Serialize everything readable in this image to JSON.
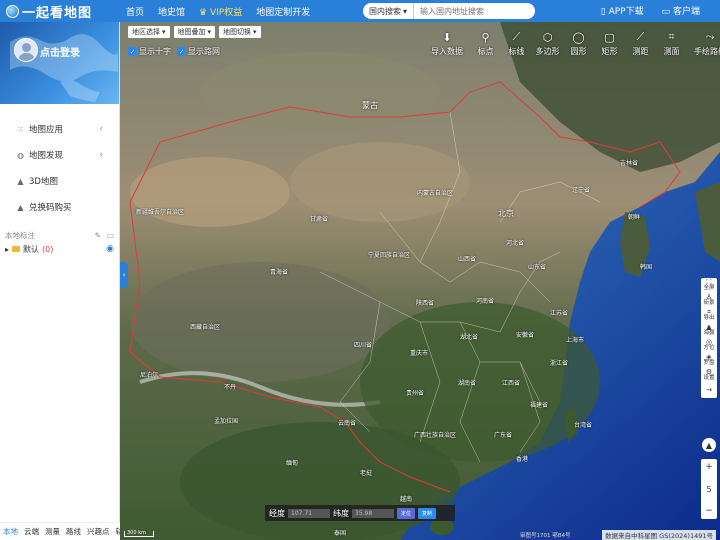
{
  "topbar": {
    "logo_text": "一起看地图",
    "nav": [
      "首页",
      "地史馆",
      "VIP权益",
      "地图定制开发"
    ],
    "search_select": "国内搜索",
    "search_placeholder": "输入国内地址搜索",
    "app_download": "APP下载",
    "client": "客户端"
  },
  "sidebar": {
    "login": "点击登录",
    "menu": [
      {
        "label": "地图应用",
        "icon": "grid-icon"
      },
      {
        "label": "地图发现",
        "icon": "globe-icon"
      },
      {
        "label": "3D地图",
        "icon": "mountain-icon"
      },
      {
        "label": "兑换码购买",
        "icon": "mountain-icon"
      }
    ],
    "layer_title": "本地标注",
    "layer_folder": "默认",
    "layer_count": "(0)",
    "bottom_tabs": [
      "本地",
      "云端",
      "测量",
      "路线",
      "兴趣点",
      "轨迹"
    ]
  },
  "map": {
    "selectors": [
      "地区选择",
      "地图叠加",
      "地图切换"
    ],
    "checks": [
      "显示十字",
      "显示路网"
    ],
    "tools": [
      "导入数据",
      "标点",
      "标线",
      "多边形",
      "圆形",
      "矩形",
      "测距",
      "测面",
      "手绘路线"
    ],
    "right_tools": [
      "全屏",
      "街景",
      "导出",
      "海拔",
      "方位",
      "罗盘",
      "设置"
    ],
    "zoom_level": "5",
    "coord_lng_label": "经度",
    "coord_lng": "107.71",
    "coord_lat_label": "纬度",
    "coord_lat": "35.98",
    "coord_btn1": "定位",
    "coord_btn2": "复制",
    "scale": "300 km",
    "credit": "数据来自中科星图 GS(2024)1491号",
    "credit2": "审图号1701 鄂B4号",
    "labels": {
      "mongolia": "蒙古",
      "beijing": "北京",
      "liaoning": "辽宁省",
      "jilin": "吉林省",
      "korea_n": "朝鲜",
      "korea_s": "韩国",
      "neimenggu": "内蒙古自治区",
      "hebei": "河北省",
      "shanxi": "山西省",
      "shandong": "山东省",
      "ningxia": "宁夏回族自治区",
      "gansu": "甘肃省",
      "xinjiang": "新疆维吾尔自治区",
      "qinghai": "青海省",
      "shaanxi": "陕西省",
      "henan": "河南省",
      "jiangsu": "江苏省",
      "anhui": "安徽省",
      "hubei": "湖北省",
      "shanghai": "上海市",
      "sichuan": "四川省",
      "chongqing": "重庆市",
      "zhejiang": "浙江省",
      "hunan": "湖南省",
      "jiangxi": "江西省",
      "guizhou": "贵州省",
      "fujian": "福建省",
      "yunnan": "云南省",
      "guangxi": "广西壮族自治区",
      "guangdong": "广东省",
      "nepal": "尼泊尔",
      "bhutan": "不丹",
      "bangladesh": "孟加拉国",
      "myanmar": "缅甸",
      "laos": "老挝",
      "vietnam": "越南",
      "taiwan": "台湾省",
      "hongkong": "香港",
      "thailand": "泰国",
      "xizang": "西藏自治区"
    }
  }
}
